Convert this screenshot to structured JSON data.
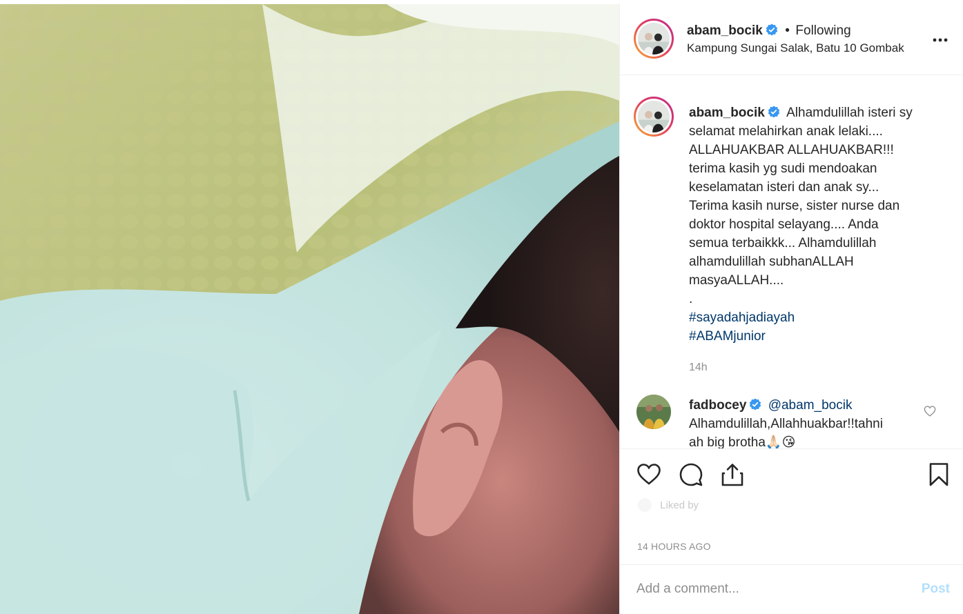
{
  "header": {
    "username": "abam_bocik",
    "separator": "•",
    "follow_status": "Following",
    "location": "Kampung Sungai Salak, Batu 10 Gombak"
  },
  "caption": {
    "username": "abam_bocik",
    "lines": [
      "Alhamdulillah isteri sy",
      "selamat melahirkan anak lelaki....",
      "ALLAHUAKBAR ALLAHUAKBAR!!!",
      "terima kasih yg sudi mendoakan",
      "keselamatan isteri dan anak sy...",
      "Terima kasih nurse, sister nurse dan",
      "doktor hospital selayang.... Anda",
      "semua terbaikkk... Alhamdulillah",
      "alhamdulillah subhanALLAH",
      "masyaALLAH....",
      "."
    ],
    "hashtags": [
      "#sayadahjadiayah",
      "#ABAMjunior"
    ],
    "time": "14h"
  },
  "comment": {
    "username": "fadbocey",
    "mention": "@abam_bocik",
    "line1": "Alhamdulillah,Allahhuakbar!!tahni",
    "line2": "ah big brotha🙏🏻😘"
  },
  "likes_text": "Liked by",
  "timestamp": "14 HOURS AGO",
  "add_comment": {
    "placeholder": "Add a comment...",
    "post_label": "Post"
  },
  "colors": {
    "verified": "#3897f0",
    "hashtag": "#00376b",
    "post_button_disabled": "#b2dffc",
    "secondary_text": "#8e8e8e"
  },
  "icons": [
    "more-options-icon",
    "verified-badge-icon",
    "heart-icon",
    "comment-icon",
    "share-icon",
    "bookmark-icon"
  ]
}
